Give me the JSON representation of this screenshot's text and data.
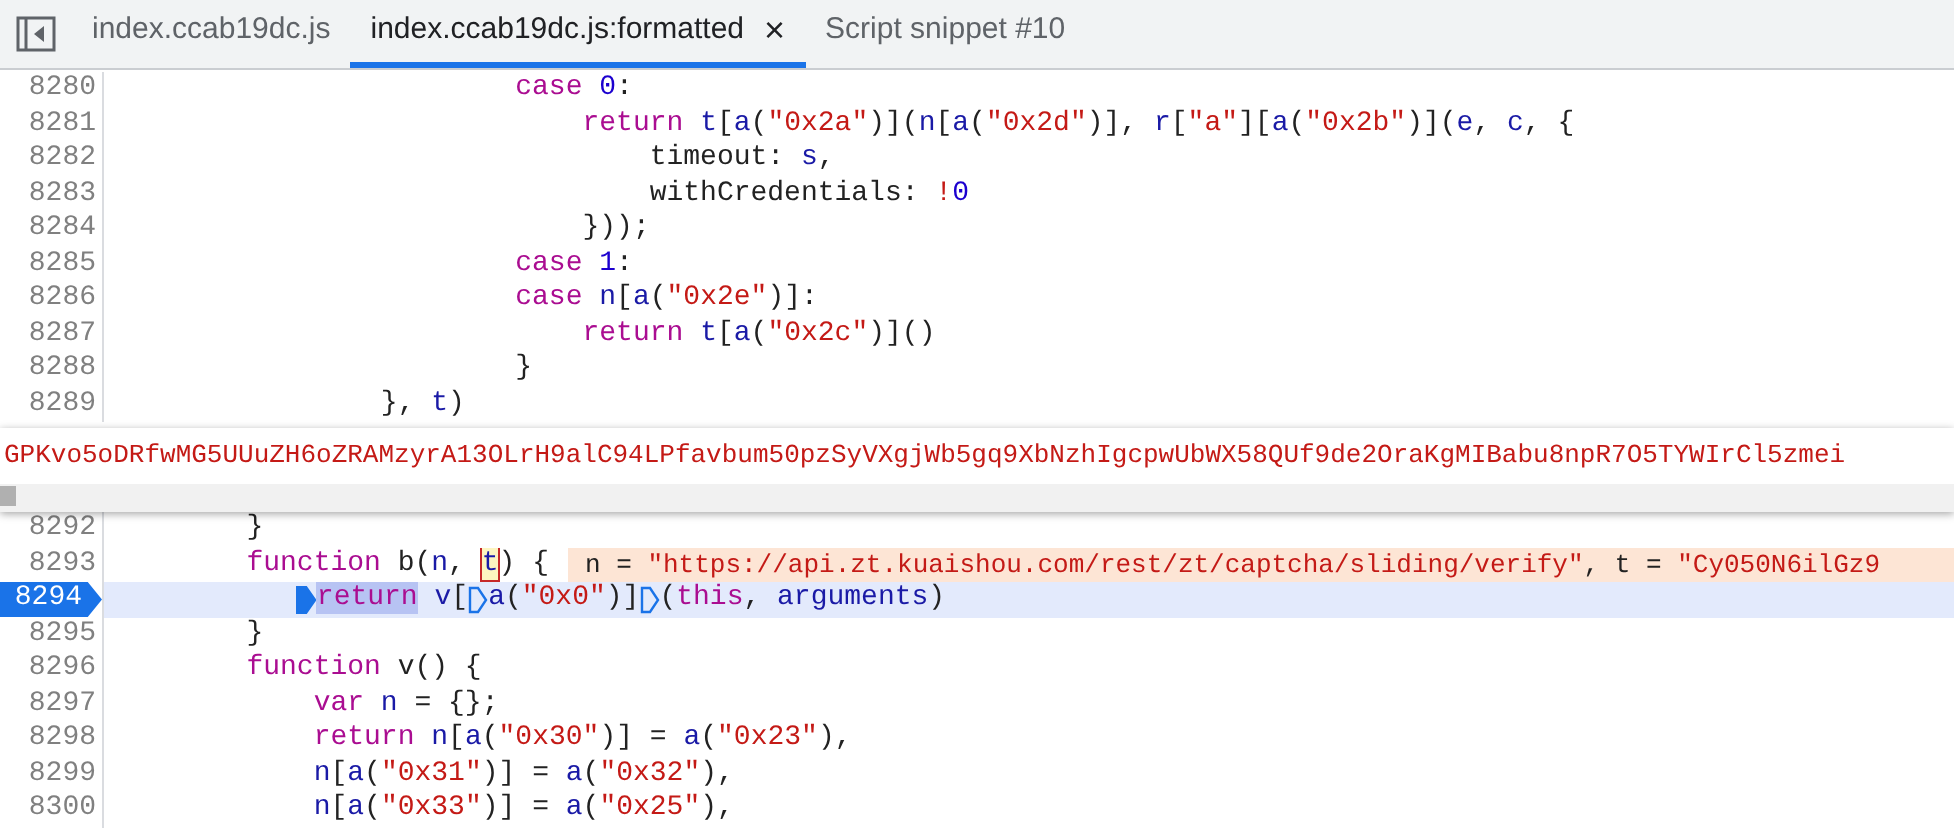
{
  "tabs": [
    {
      "label": "index.ccab19dc.js",
      "selected": false,
      "closable": false
    },
    {
      "label": "index.ccab19dc.js:formatted",
      "selected": true,
      "closable": true,
      "close": "×"
    },
    {
      "label": "Script snippet #10",
      "selected": false,
      "closable": false
    }
  ],
  "code_top": [
    {
      "number": "8280",
      "current": false,
      "tokens": [
        {
          "kind": "keyword",
          "text": "                        case "
        },
        {
          "kind": "number",
          "text": "0"
        },
        {
          "kind": "plain",
          "text": ":"
        }
      ]
    },
    {
      "number": "8281",
      "current": false,
      "tokens": [
        {
          "kind": "keyword",
          "text": "                            return "
        },
        {
          "kind": "variable",
          "text": "t"
        },
        {
          "kind": "plain",
          "text": "["
        },
        {
          "kind": "variable",
          "text": "a"
        },
        {
          "kind": "plain",
          "text": "("
        },
        {
          "kind": "string",
          "text": "\"0x2a\""
        },
        {
          "kind": "plain",
          "text": ")]("
        },
        {
          "kind": "variable",
          "text": "n"
        },
        {
          "kind": "plain",
          "text": "["
        },
        {
          "kind": "variable",
          "text": "a"
        },
        {
          "kind": "plain",
          "text": "("
        },
        {
          "kind": "string",
          "text": "\"0x2d\""
        },
        {
          "kind": "plain",
          "text": ")], "
        },
        {
          "kind": "variable",
          "text": "r"
        },
        {
          "kind": "plain",
          "text": "["
        },
        {
          "kind": "string",
          "text": "\"a\""
        },
        {
          "kind": "plain",
          "text": "]["
        },
        {
          "kind": "variable",
          "text": "a"
        },
        {
          "kind": "plain",
          "text": "("
        },
        {
          "kind": "string",
          "text": "\"0x2b\""
        },
        {
          "kind": "plain",
          "text": ")]("
        },
        {
          "kind": "variable",
          "text": "e"
        },
        {
          "kind": "plain",
          "text": ", "
        },
        {
          "kind": "variable",
          "text": "c"
        },
        {
          "kind": "plain",
          "text": ", {"
        }
      ]
    },
    {
      "number": "8282",
      "current": false,
      "tokens": [
        {
          "kind": "plain",
          "text": "                                timeout: "
        },
        {
          "kind": "variable",
          "text": "s"
        },
        {
          "kind": "plain",
          "text": ","
        }
      ]
    },
    {
      "number": "8283",
      "current": false,
      "tokens": [
        {
          "kind": "plain",
          "text": "                                withCredentials: "
        },
        {
          "kind": "string",
          "text": "!"
        },
        {
          "kind": "number",
          "text": "0"
        }
      ]
    },
    {
      "number": "8284",
      "current": false,
      "tokens": [
        {
          "kind": "plain",
          "text": "                            }));"
        }
      ]
    },
    {
      "number": "8285",
      "current": false,
      "tokens": [
        {
          "kind": "keyword",
          "text": "                        case "
        },
        {
          "kind": "number",
          "text": "1"
        },
        {
          "kind": "plain",
          "text": ":"
        }
      ]
    },
    {
      "number": "8286",
      "current": false,
      "tokens": [
        {
          "kind": "keyword",
          "text": "                        case "
        },
        {
          "kind": "variable",
          "text": "n"
        },
        {
          "kind": "plain",
          "text": "["
        },
        {
          "kind": "variable",
          "text": "a"
        },
        {
          "kind": "plain",
          "text": "("
        },
        {
          "kind": "string",
          "text": "\"0x2e\""
        },
        {
          "kind": "plain",
          "text": ")]:"
        }
      ]
    },
    {
      "number": "8287",
      "current": false,
      "tokens": [
        {
          "kind": "keyword",
          "text": "                            return "
        },
        {
          "kind": "variable",
          "text": "t"
        },
        {
          "kind": "plain",
          "text": "["
        },
        {
          "kind": "variable",
          "text": "a"
        },
        {
          "kind": "plain",
          "text": "("
        },
        {
          "kind": "string",
          "text": "\"0x2c\""
        },
        {
          "kind": "plain",
          "text": ")]()"
        }
      ]
    },
    {
      "number": "8288",
      "current": false,
      "tokens": [
        {
          "kind": "plain",
          "text": "                        }"
        }
      ]
    },
    {
      "number": "8289",
      "current": false,
      "tokens": [
        {
          "kind": "plain",
          "text": "                }, "
        },
        {
          "kind": "variable",
          "text": "t"
        },
        {
          "kind": "plain",
          "text": ")"
        }
      ]
    }
  ],
  "popup": {
    "text": "GPKvo5oDRfwMG5UUuZH6oZRAMzyrA13OLrH9alC94LPfavbum50pzSyVXgjWb5gq9XbNzhIgcpwUbWX58QUf9de2OraKgMIBabu8npR7O5TYWIrCl5zmei"
  },
  "code_bottom": [
    {
      "number": "8292",
      "current": false,
      "tokens": [
        {
          "kind": "plain",
          "text": "        }"
        }
      ]
    },
    {
      "number": "8293",
      "current": false,
      "tokens": [
        {
          "kind": "keyword",
          "text": "        function "
        },
        {
          "kind": "plain",
          "text": "b("
        },
        {
          "kind": "variable",
          "text": "n"
        },
        {
          "kind": "plain",
          "text": ", "
        },
        {
          "kind": "variable",
          "text": "t",
          "hovered": true
        },
        {
          "kind": "plain",
          "text": ") {"
        }
      ],
      "inline_value": [
        {
          "kind": "plain",
          "text": "n = "
        },
        {
          "kind": "string",
          "text": "\"https://api.zt.kuaishou.com/rest/zt/captcha/sliding/verify\""
        },
        {
          "kind": "plain",
          "text": ", t = "
        },
        {
          "kind": "string",
          "text": "\"Cy050N6ilGz9"
        }
      ]
    },
    {
      "number": "8294",
      "current": true,
      "tokens": [
        {
          "kind": "marker",
          "active": true
        },
        {
          "kind": "keyword",
          "text": "            return",
          "highlighted": true
        },
        {
          "kind": "variable",
          "text": " v"
        },
        {
          "kind": "plain",
          "text": "["
        },
        {
          "kind": "marker",
          "active": false
        },
        {
          "kind": "variable",
          "text": "a"
        },
        {
          "kind": "plain",
          "text": "("
        },
        {
          "kind": "string",
          "text": "\"0x0\""
        },
        {
          "kind": "plain",
          "text": ")]"
        },
        {
          "kind": "marker",
          "active": false
        },
        {
          "kind": "plain",
          "text": "("
        },
        {
          "kind": "keyword",
          "text": "this"
        },
        {
          "kind": "plain",
          "text": ", "
        },
        {
          "kind": "variable",
          "text": "arguments"
        },
        {
          "kind": "plain",
          "text": ")"
        }
      ]
    },
    {
      "number": "8295",
      "current": false,
      "tokens": [
        {
          "kind": "plain",
          "text": "        }"
        }
      ]
    },
    {
      "number": "8296",
      "current": false,
      "tokens": [
        {
          "kind": "keyword",
          "text": "        function "
        },
        {
          "kind": "plain",
          "text": "v() {"
        }
      ]
    },
    {
      "number": "8297",
      "current": false,
      "tokens": [
        {
          "kind": "keyword",
          "text": "            var "
        },
        {
          "kind": "variable",
          "text": "n"
        },
        {
          "kind": "plain",
          "text": " = {};"
        }
      ]
    },
    {
      "number": "8298",
      "current": false,
      "tokens": [
        {
          "kind": "keyword",
          "text": "            return "
        },
        {
          "kind": "variable",
          "text": "n"
        },
        {
          "kind": "plain",
          "text": "["
        },
        {
          "kind": "variable",
          "text": "a"
        },
        {
          "kind": "plain",
          "text": "("
        },
        {
          "kind": "string",
          "text": "\"0x30\""
        },
        {
          "kind": "plain",
          "text": ")] = "
        },
        {
          "kind": "variable",
          "text": "a"
        },
        {
          "kind": "plain",
          "text": "("
        },
        {
          "kind": "string",
          "text": "\"0x23\""
        },
        {
          "kind": "plain",
          "text": "),"
        }
      ]
    },
    {
      "number": "8299",
      "current": false,
      "tokens": [
        {
          "kind": "variable",
          "text": "            n"
        },
        {
          "kind": "plain",
          "text": "["
        },
        {
          "kind": "variable",
          "text": "a"
        },
        {
          "kind": "plain",
          "text": "("
        },
        {
          "kind": "string",
          "text": "\"0x31\""
        },
        {
          "kind": "plain",
          "text": ")] = "
        },
        {
          "kind": "variable",
          "text": "a"
        },
        {
          "kind": "plain",
          "text": "("
        },
        {
          "kind": "string",
          "text": "\"0x32\""
        },
        {
          "kind": "plain",
          "text": "),"
        }
      ]
    },
    {
      "number": "8300",
      "current": false,
      "tokens": [
        {
          "kind": "variable",
          "text": "            n"
        },
        {
          "kind": "plain",
          "text": "["
        },
        {
          "kind": "variable",
          "text": "a"
        },
        {
          "kind": "plain",
          "text": "("
        },
        {
          "kind": "string",
          "text": "\"0x33\""
        },
        {
          "kind": "plain",
          "text": ")] = "
        },
        {
          "kind": "variable",
          "text": "a"
        },
        {
          "kind": "plain",
          "text": "("
        },
        {
          "kind": "string",
          "text": "\"0x25\""
        },
        {
          "kind": "plain",
          "text": "),"
        }
      ]
    }
  ]
}
